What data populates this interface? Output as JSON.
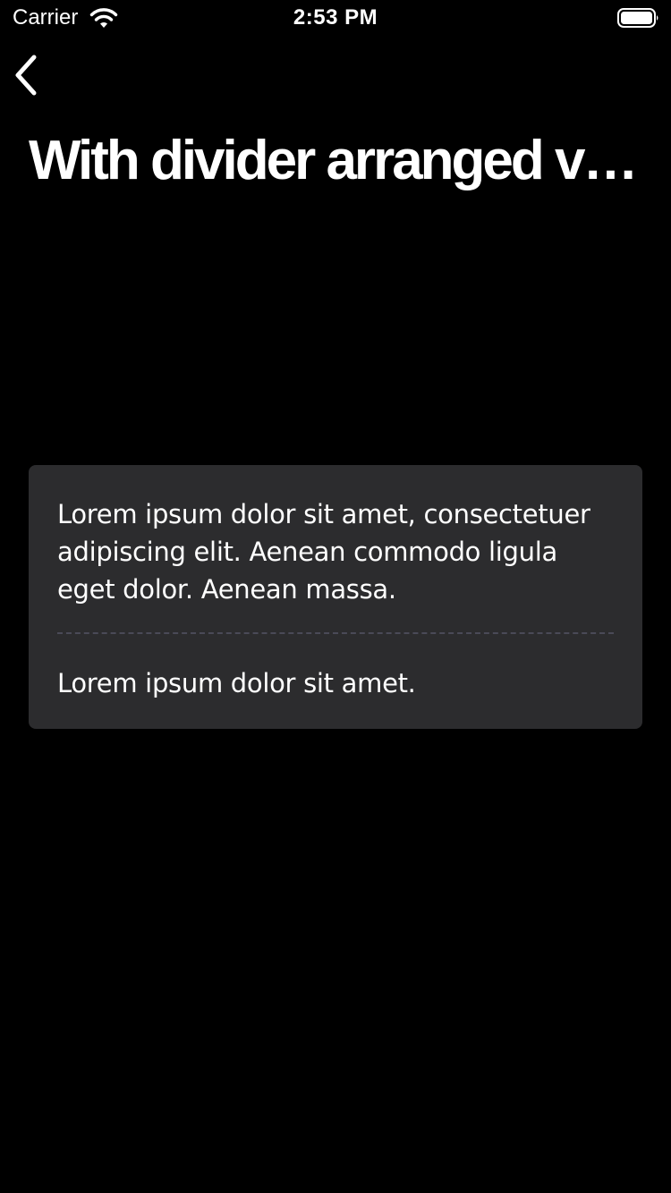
{
  "status_bar": {
    "carrier": "Carrier",
    "time": "2:53 PM",
    "wifi_icon": "wifi-icon",
    "battery_icon": "battery-icon"
  },
  "nav": {
    "back_icon": "chevron-left-icon"
  },
  "page": {
    "title": "With divider arranged ve..."
  },
  "card": {
    "background": "#2c2c2e",
    "items": [
      {
        "text": "Lorem ipsum dolor sit amet, consectetuer adipiscing elit. Aenean commodo ligula eget dolor. Aenean massa."
      },
      {
        "text": "Lorem ipsum dolor sit amet."
      }
    ],
    "divider_style": "dashed",
    "divider_color": "#4a4a57"
  },
  "colors": {
    "background": "#000000",
    "text": "#ffffff"
  }
}
